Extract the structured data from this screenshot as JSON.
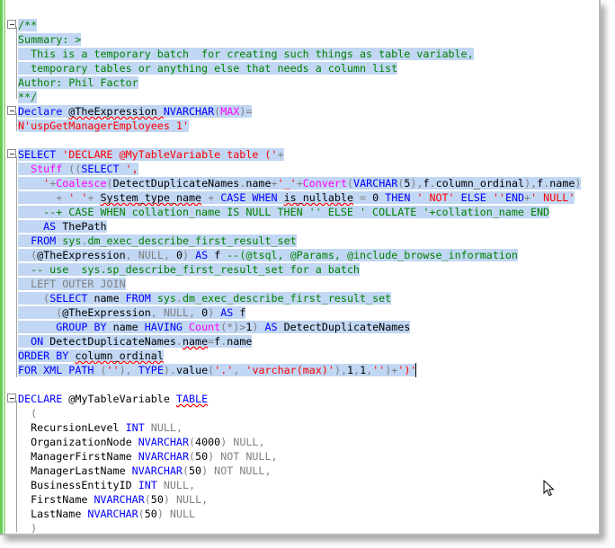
{
  "editor": {
    "lines": [
      [
        [
          "/**",
          "cm"
        ]
      ],
      [
        [
          "Summary: >",
          "cm"
        ]
      ],
      [
        [
          "  This is a temporary batch  for creating such things as table variable,",
          "cm"
        ]
      ],
      [
        [
          "  temporary tables or anything else that needs a column list",
          "cm"
        ]
      ],
      [
        [
          "Author: Phil Factor",
          "cm"
        ]
      ],
      [
        [
          "**/",
          "cm"
        ]
      ],
      [
        [
          "Declare ",
          "kw"
        ],
        [
          "@TheExpression ",
          "tx sq"
        ],
        [
          "NVARCHAR",
          "kw"
        ],
        [
          "(",
          "gy"
        ],
        [
          "MAX",
          "fn"
        ],
        [
          ")",
          "gy"
        ],
        [
          "=",
          "gy"
        ]
      ],
      [
        [
          "N'uspGetManagerEmployees 1'",
          "str"
        ]
      ],
      [
        [
          "",
          ""
        ]
      ],
      [
        [
          "SELECT ",
          "kw"
        ],
        [
          "'DECLARE @MyTableVariable table ('",
          "str"
        ],
        [
          "+",
          "gy"
        ]
      ],
      [
        [
          "  Stuff ",
          "fn"
        ],
        [
          "((",
          "gy"
        ],
        [
          "SELECT ",
          "kw"
        ],
        [
          "',",
          "str"
        ]
      ],
      [
        [
          "    '",
          "str"
        ],
        [
          "+",
          "gy"
        ],
        [
          "Coalesce",
          "fn"
        ],
        [
          "(",
          "gy"
        ],
        [
          "DetectDuplicateNames",
          "tx"
        ],
        [
          ".",
          "gy"
        ],
        [
          "name",
          "tx"
        ],
        [
          "+",
          "gy"
        ],
        [
          "'_'",
          "str"
        ],
        [
          "+",
          "gy"
        ],
        [
          "Convert",
          "fn"
        ],
        [
          "(",
          "gy"
        ],
        [
          "VARCHAR",
          "kw"
        ],
        [
          "(",
          "gy"
        ],
        [
          "5",
          "tx"
        ],
        [
          "),",
          "gy"
        ],
        [
          "f",
          "tx"
        ],
        [
          ".",
          "gy"
        ],
        [
          "column_ordinal",
          "tx"
        ],
        [
          "),",
          "gy"
        ],
        [
          "f",
          "tx"
        ],
        [
          ".",
          "gy"
        ],
        [
          "name",
          "tx"
        ],
        [
          ")",
          "gy"
        ]
      ],
      [
        [
          "      + ",
          "gy"
        ],
        [
          "' '",
          "str"
        ],
        [
          "+ ",
          "gy"
        ],
        [
          "System_type_name",
          "tx sq"
        ],
        [
          " + ",
          "gy"
        ],
        [
          "CASE WHEN ",
          "kw"
        ],
        [
          "is_nullable",
          "tx sq"
        ],
        [
          " = ",
          "gy"
        ],
        [
          "0 ",
          "tx"
        ],
        [
          "THEN ",
          "kw"
        ],
        [
          "' NOT'",
          "str"
        ],
        [
          " ELSE ",
          "kw"
        ],
        [
          "''",
          "str"
        ],
        [
          "END",
          "kw"
        ],
        [
          "+",
          "gy"
        ],
        [
          "' NULL'",
          "str"
        ]
      ],
      [
        [
          "    --+ CASE WHEN collation_name IS NULL THEN '' ELSE ' COLLATE '+collation_name END",
          "cm"
        ]
      ],
      [
        [
          "    AS ",
          "kw"
        ],
        [
          "ThePath",
          "tx"
        ]
      ],
      [
        [
          "  FROM ",
          "kw"
        ],
        [
          "sys",
          "sys"
        ],
        [
          ".",
          "gy"
        ],
        [
          "dm_exec_describe_first_result_set",
          "sys"
        ]
      ],
      [
        [
          "  (",
          "gy"
        ],
        [
          "@TheExpression",
          "tx"
        ],
        [
          ", ",
          "gy"
        ],
        [
          "NULL",
          "gy"
        ],
        [
          ", ",
          "gy"
        ],
        [
          "0",
          "tx"
        ],
        [
          ") ",
          "gy"
        ],
        [
          "AS ",
          "kw"
        ],
        [
          "f ",
          "tx"
        ],
        [
          "--(@tsql, @Params, @include_browse_information",
          "cm"
        ]
      ],
      [
        [
          "  -- use  sys.sp_describe_first_result_set for a batch",
          "cm"
        ]
      ],
      [
        [
          "  LEFT OUTER JOIN",
          "gy"
        ]
      ],
      [
        [
          "    (",
          "gy"
        ],
        [
          "SELECT ",
          "kw"
        ],
        [
          "name ",
          "tx"
        ],
        [
          "FROM ",
          "kw"
        ],
        [
          "sys",
          "sys"
        ],
        [
          ".",
          "gy"
        ],
        [
          "dm_exec_describe_first_result_set",
          "sys"
        ]
      ],
      [
        [
          "      (",
          "gy"
        ],
        [
          "@TheExpression",
          "tx"
        ],
        [
          ", ",
          "gy"
        ],
        [
          "NULL",
          "gy"
        ],
        [
          ", ",
          "gy"
        ],
        [
          "0",
          "tx"
        ],
        [
          ") ",
          "gy"
        ],
        [
          "AS ",
          "kw"
        ],
        [
          "f",
          "tx"
        ]
      ],
      [
        [
          "      GROUP BY ",
          "kw"
        ],
        [
          "name ",
          "tx"
        ],
        [
          "HAVING ",
          "kw"
        ],
        [
          "Count",
          "fn"
        ],
        [
          "(*)>",
          "gy"
        ],
        [
          "1",
          "tx"
        ],
        [
          ") ",
          "gy"
        ],
        [
          "AS ",
          "kw"
        ],
        [
          "DetectDuplicateNames",
          "tx"
        ]
      ],
      [
        [
          "  ON ",
          "kw"
        ],
        [
          "DetectDuplicateNames",
          "tx"
        ],
        [
          ".",
          "gy"
        ],
        [
          "name",
          "tx sq"
        ],
        [
          "=",
          "gy"
        ],
        [
          "f",
          "tx"
        ],
        [
          ".",
          "gy"
        ],
        [
          "name",
          "tx"
        ]
      ],
      [
        [
          "ORDER BY ",
          "kw"
        ],
        [
          "column_ordinal",
          "tx sq"
        ]
      ],
      [
        [
          "FOR XML PATH ",
          "kw"
        ],
        [
          "(",
          "gy"
        ],
        [
          "''",
          "str"
        ],
        [
          "), ",
          "gy"
        ],
        [
          "TYPE",
          "kw"
        ],
        [
          ").",
          "gy"
        ],
        [
          "value",
          "tx"
        ],
        [
          "(",
          "gy"
        ],
        [
          "'.'",
          "str"
        ],
        [
          ", ",
          "gy"
        ],
        [
          "'varchar(max)'",
          "str"
        ],
        [
          "),",
          "gy"
        ],
        [
          "1",
          "tx"
        ],
        [
          ",",
          "gy"
        ],
        [
          "1",
          "tx"
        ],
        [
          ",",
          "gy"
        ],
        [
          "''",
          "str"
        ],
        [
          ")+",
          "gy"
        ],
        [
          "')'",
          "str"
        ]
      ],
      [
        [
          "",
          ""
        ]
      ],
      [
        [
          "DECLARE ",
          "kw"
        ],
        [
          "@MyTableVariable ",
          "tx"
        ],
        [
          "TABLE",
          "kw sq"
        ]
      ],
      [
        [
          "  (",
          "gy"
        ]
      ],
      [
        [
          "  RecursionLevel ",
          "tx"
        ],
        [
          "INT ",
          "kw"
        ],
        [
          "NULL",
          "gy"
        ],
        [
          ",",
          "gy"
        ]
      ],
      [
        [
          "  OrganizationNode ",
          "tx"
        ],
        [
          "NVARCHAR",
          "kw"
        ],
        [
          "(",
          "gy"
        ],
        [
          "4000",
          "tx"
        ],
        [
          ") ",
          "gy"
        ],
        [
          "NULL",
          "gy"
        ],
        [
          ",",
          "gy"
        ]
      ],
      [
        [
          "  ManagerFirstName ",
          "tx"
        ],
        [
          "NVARCHAR",
          "kw"
        ],
        [
          "(",
          "gy"
        ],
        [
          "50",
          "tx"
        ],
        [
          ") ",
          "gy"
        ],
        [
          "NOT NULL",
          "gy"
        ],
        [
          ",",
          "gy"
        ]
      ],
      [
        [
          "  ManagerLastName ",
          "tx"
        ],
        [
          "NVARCHAR",
          "kw"
        ],
        [
          "(",
          "gy"
        ],
        [
          "50",
          "tx"
        ],
        [
          ") ",
          "gy"
        ],
        [
          "NOT NULL",
          "gy"
        ],
        [
          ",",
          "gy"
        ]
      ],
      [
        [
          "  BusinessEntityID ",
          "tx"
        ],
        [
          "INT ",
          "kw"
        ],
        [
          "NULL",
          "gy"
        ],
        [
          ",",
          "gy"
        ]
      ],
      [
        [
          "  FirstName ",
          "tx"
        ],
        [
          "NVARCHAR",
          "kw"
        ],
        [
          "(",
          "gy"
        ],
        [
          "50",
          "tx"
        ],
        [
          ") ",
          "gy"
        ],
        [
          "NULL",
          "gy"
        ],
        [
          ",",
          "gy"
        ]
      ],
      [
        [
          "  LastName ",
          "tx"
        ],
        [
          "NVARCHAR",
          "kw"
        ],
        [
          "(",
          "gy"
        ],
        [
          "50",
          "tx"
        ],
        [
          ") ",
          "gy"
        ],
        [
          "NULL",
          "gy"
        ]
      ],
      [
        [
          "  )",
          "gy"
        ]
      ]
    ],
    "colors": {
      "selection": "#c1d7f3",
      "keyword": "#0000ff",
      "string": "#ff0000",
      "function": "#ff00ff",
      "operator": "#808080",
      "comment": "#008000",
      "change_bar": "#66cc55"
    },
    "icons": [
      "collapse-icon",
      "mouse-pointer-icon"
    ]
  }
}
